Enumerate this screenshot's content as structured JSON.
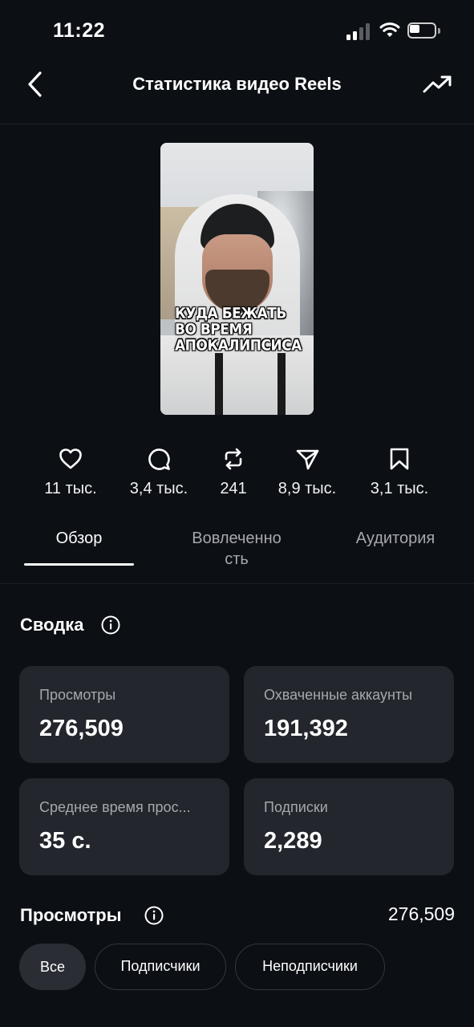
{
  "status_bar": {
    "time": "11:22"
  },
  "header": {
    "title": "Статистика видео Reels"
  },
  "thumbnail": {
    "caption_lines": [
      "КУДА БЕЖАТЬ",
      "ВО ВРЕМЯ",
      "АПОКАЛИПСИСА"
    ]
  },
  "metrics": [
    {
      "icon": "heart-icon",
      "value": "11 тыс."
    },
    {
      "icon": "comment-icon",
      "value": "3,4 тыс."
    },
    {
      "icon": "repost-icon",
      "value": "241"
    },
    {
      "icon": "share-icon",
      "value": "8,9 тыс."
    },
    {
      "icon": "bookmark-icon",
      "value": "3,1 тыс."
    }
  ],
  "tabs": [
    {
      "label": "Обзор",
      "active": true
    },
    {
      "label_line1": "Вовлеченно",
      "label_line2": "сть",
      "active": false
    },
    {
      "label": "Аудитория",
      "active": false
    }
  ],
  "summary": {
    "title": "Сводка",
    "cards": [
      {
        "label": "Просмотры",
        "value": "276,509"
      },
      {
        "label": "Охваченные аккаунты",
        "value": "191,392"
      },
      {
        "label": "Среднее время прос...",
        "value": "35 с."
      },
      {
        "label": "Подписки",
        "value": "2,289"
      }
    ]
  },
  "views": {
    "title": "Просмотры",
    "total": "276,509",
    "filters": [
      {
        "label": "Все",
        "active": true
      },
      {
        "label": "Подписчики",
        "active": false
      },
      {
        "label": "Неподписчики",
        "active": false
      }
    ]
  },
  "colors": {
    "background": "#0c0f14",
    "card": "#23262c",
    "muted_text": "#a6a8ad"
  }
}
